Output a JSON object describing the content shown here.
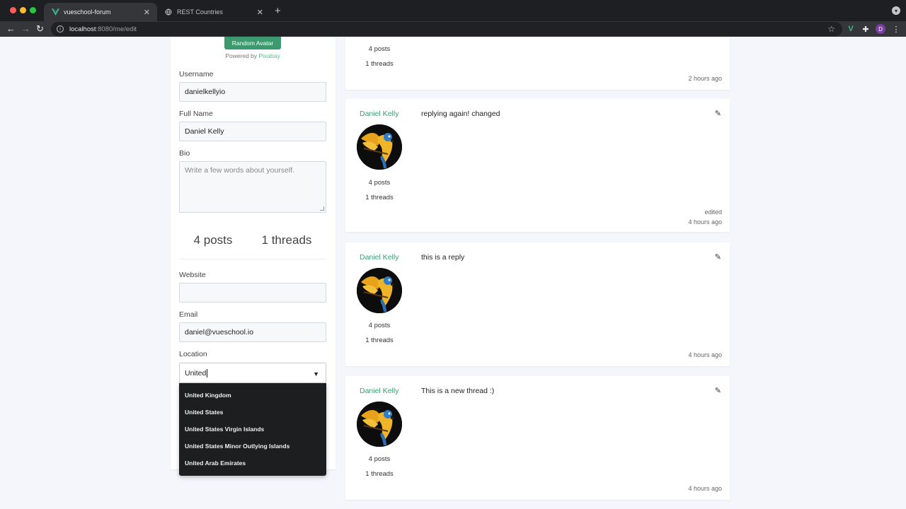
{
  "browser": {
    "tabs": [
      {
        "title": "vueschool-forum",
        "active": true
      },
      {
        "title": "REST Countries",
        "active": false
      }
    ],
    "url_host": "localhost",
    "url_path": ":8080/me/edit",
    "profile_initial": "D"
  },
  "profile": {
    "random_avatar_label": "Random Avatar",
    "powered_by": "Powered by ",
    "powered_by_link": "Pixabay",
    "username_label": "Username",
    "username_value": "danielkellyio",
    "fullname_label": "Full Name",
    "fullname_value": "Daniel Kelly",
    "bio_label": "Bio",
    "bio_placeholder": "Write a few words about yourself.",
    "posts_stat": "4 posts",
    "threads_stat": "1 threads",
    "website_label": "Website",
    "website_value": "",
    "email_label": "Email",
    "email_value": "daniel@vueschool.io",
    "location_label": "Location",
    "location_value": "United",
    "location_options": [
      "United Kingdom",
      "United States",
      "United States Virgin Islands",
      "United States Minor Outlying Islands",
      "United Arab Emirates"
    ]
  },
  "posts": [
    {
      "author": "",
      "text": "",
      "posts": "4 posts",
      "threads": "1 threads",
      "edited": "",
      "time": "2 hours ago"
    },
    {
      "author": "Daniel Kelly",
      "text": "replying again! changed",
      "posts": "4 posts",
      "threads": "1 threads",
      "edited": "edited",
      "time": "4 hours ago"
    },
    {
      "author": "Daniel Kelly",
      "text": "this is a reply",
      "posts": "4 posts",
      "threads": "1 threads",
      "edited": "",
      "time": "4 hours ago"
    },
    {
      "author": "Daniel Kelly",
      "text": "This is a new thread :)",
      "posts": "4 posts",
      "threads": "1 threads",
      "edited": "",
      "time": "4 hours ago"
    }
  ],
  "icons": {
    "edit": "pencil-icon",
    "avatar": "parrot-avatar-image"
  },
  "colors": {
    "accent": "#3b9b6f",
    "author": "#3a9d72",
    "dropdown_bg": "#1d1e20"
  }
}
